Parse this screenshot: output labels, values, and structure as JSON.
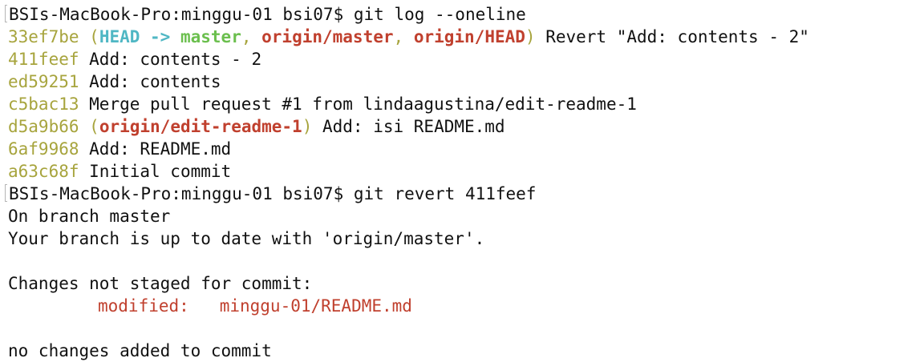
{
  "terminal": {
    "prompt1": {
      "prompt": "BSIs-MacBook-Pro:minggu-01 bsi07$ ",
      "command": "git log --oneline"
    },
    "commits": [
      {
        "hash": "33ef7be",
        "deco_open": "(",
        "head": "HEAD -> ",
        "local_branch": "master",
        "sep1": ", ",
        "remote1": "origin/master",
        "sep2": ", ",
        "remote2": "origin/HEAD",
        "deco_close": ")",
        "message": " Revert \"Add: contents - 2\""
      },
      {
        "hash": "411feef",
        "message": " Add: contents - 2"
      },
      {
        "hash": "ed59251",
        "message": " Add: contents"
      },
      {
        "hash": "c5bac13",
        "message": " Merge pull request #1 from lindaagustina/edit-readme-1"
      },
      {
        "hash": "d5a9b66",
        "deco_open": "(",
        "remote1": "origin/edit-readme-1",
        "deco_close": ")",
        "message": " Add: isi README.md"
      },
      {
        "hash": "6af9968",
        "message": " Add: README.md"
      },
      {
        "hash": "a63c68f",
        "message": " Initial commit"
      }
    ],
    "prompt2": {
      "prompt": "BSIs-MacBook-Pro:minggu-01 bsi07$ ",
      "command": "git revert 411feef"
    },
    "output": {
      "on_branch": "On branch master",
      "up_to_date": "Your branch is up to date with 'origin/master'.",
      "changes_header": "Changes not staged for commit:",
      "modified_label": "modified:   ",
      "modified_file": "minggu-01/README.md",
      "no_changes": "no changes added to commit"
    },
    "colors": {
      "hash": "#a7a43d",
      "head": "#4fb7c4",
      "local_branch": "#6bbf4e",
      "remote_branch": "#c0402e",
      "text": "#111111"
    }
  }
}
